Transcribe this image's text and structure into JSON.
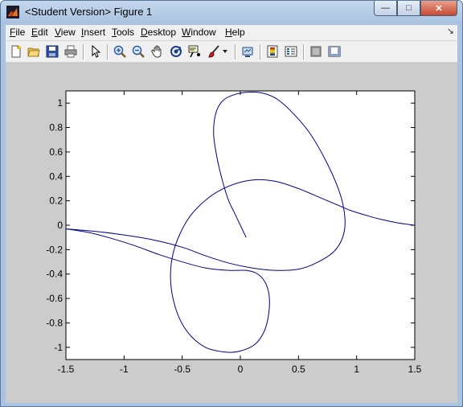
{
  "window": {
    "title": "<Student Version> Figure 1",
    "controls": {
      "minimize": "—",
      "maximize": "□",
      "close": "✕"
    }
  },
  "menubar": {
    "items": [
      "File",
      "Edit",
      "View",
      "Insert",
      "Tools",
      "Desktop",
      "Window",
      "Help"
    ],
    "overflow_arrow": "↘"
  },
  "toolbar": {
    "buttons": [
      "new-figure-icon",
      "open-file-icon",
      "save-icon",
      "print-icon",
      "edit-plot-arrow-icon",
      "zoom-in-icon",
      "zoom-out-icon",
      "pan-hand-icon",
      "rotate-3d-icon",
      "data-cursor-icon",
      "brush-icon",
      "brush-dropdown-icon",
      "link-plot-icon",
      "insert-colorbar-icon",
      "insert-legend-icon",
      "hide-plot-tools-icon",
      "show-plot-tools-icon"
    ]
  },
  "colors": {
    "line": "#00008b",
    "figure_bg": "#cccccc",
    "axes_bg": "#ffffff"
  },
  "chart_data": {
    "type": "line",
    "title": "",
    "xlabel": "",
    "ylabel": "",
    "xlim": [
      -1.5,
      1.5
    ],
    "ylim": [
      -1.1,
      1.1
    ],
    "xticks": [
      -1.5,
      -1,
      -0.5,
      0,
      0.5,
      1,
      1.5
    ],
    "xtick_labels": [
      "-1.5",
      "-1",
      "-0.5",
      "0",
      "0.5",
      "1",
      "1.5"
    ],
    "yticks": [
      -1,
      -0.8,
      -0.6,
      -0.4,
      -0.2,
      0,
      0.2,
      0.4,
      0.6,
      0.8,
      1
    ],
    "ytick_labels": [
      "-1",
      "-0.8",
      "-0.6",
      "-0.4",
      "-0.2",
      "0",
      "0.2",
      "0.4",
      "0.6",
      "0.8",
      "1"
    ],
    "grid": false,
    "series": [
      {
        "x": [
          0.05,
          0.0,
          -0.05,
          -0.1,
          -0.15,
          -0.2,
          -0.23,
          -0.21,
          -0.15,
          -0.05,
          0.08,
          0.2,
          0.32,
          0.45,
          0.6,
          0.75,
          0.86,
          0.9,
          0.88,
          0.8,
          0.65,
          0.5,
          0.3,
          0.1,
          -0.1,
          -0.3,
          -0.5,
          -0.75,
          -1.0,
          -1.25,
          -1.5
        ],
        "y": [
          -0.1,
          0.0,
          0.1,
          0.2,
          0.35,
          0.55,
          0.75,
          0.92,
          1.02,
          1.07,
          1.09,
          1.08,
          1.03,
          0.92,
          0.75,
          0.5,
          0.25,
          0.05,
          -0.1,
          -0.22,
          -0.31,
          -0.36,
          -0.37,
          -0.35,
          -0.31,
          -0.25,
          -0.18,
          -0.12,
          -0.08,
          -0.05,
          -0.03
        ]
      },
      {
        "x": [
          -1.5,
          -1.3,
          -1.1,
          -0.9,
          -0.7,
          -0.5,
          -0.3,
          -0.1,
          0.05,
          0.15,
          0.22,
          0.25,
          0.24,
          0.2,
          0.12,
          0.0,
          -0.12,
          -0.3,
          -0.45,
          -0.55,
          -0.6,
          -0.57,
          -0.45,
          -0.28,
          -0.1,
          0.1,
          0.3,
          0.5,
          0.7,
          0.85,
          0.95,
          1.05,
          1.2,
          1.35,
          1.5
        ],
        "y": [
          -0.03,
          -0.06,
          -0.11,
          -0.17,
          -0.24,
          -0.3,
          -0.35,
          -0.37,
          -0.37,
          -0.4,
          -0.48,
          -0.6,
          -0.75,
          -0.88,
          -0.98,
          -1.03,
          -1.04,
          -1.0,
          -0.88,
          -0.7,
          -0.45,
          -0.2,
          0.05,
          0.22,
          0.32,
          0.37,
          0.36,
          0.3,
          0.22,
          0.16,
          0.12,
          0.09,
          0.05,
          0.02,
          0.0
        ]
      }
    ]
  }
}
